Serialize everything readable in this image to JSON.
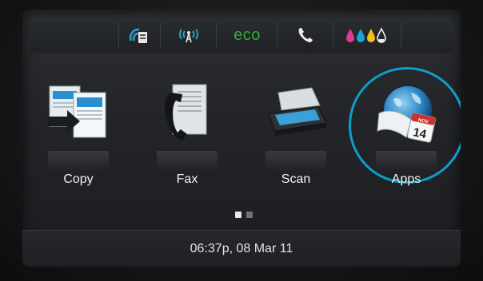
{
  "status_bar": {
    "items": [
      {
        "icon": "wireless-direct-icon",
        "color": "#27a3c9"
      },
      {
        "icon": "wireless-signal-icon",
        "color": "#27a3c9"
      },
      {
        "icon": "eco-icon",
        "text": "eco",
        "color": "#2fae34"
      },
      {
        "icon": "phone-icon",
        "color": "#e6e6e6"
      },
      {
        "icon": "ink-levels-icon",
        "ink_colors": [
          "#e23a93",
          "#1aa3db",
          "#f2c21a",
          "#f0f0f0"
        ]
      }
    ]
  },
  "tiles": [
    {
      "id": "copy",
      "label": "Copy",
      "icon": "copy-icon"
    },
    {
      "id": "fax",
      "label": "Fax",
      "icon": "fax-icon"
    },
    {
      "id": "scan",
      "label": "Scan",
      "icon": "scan-icon"
    },
    {
      "id": "apps",
      "label": "Apps",
      "icon": "apps-icon",
      "selected": true,
      "calendar_month": "NOV",
      "calendar_day": "14"
    }
  ],
  "highlight_color": "#0e9ecb",
  "pagination": {
    "total_pages": 2,
    "current_page": 1
  },
  "footer": {
    "datetime": "06:37p, 08 Mar 11"
  }
}
